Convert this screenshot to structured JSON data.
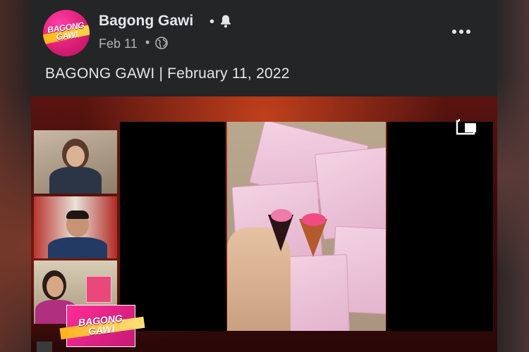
{
  "post": {
    "page_name": "Bagong Gawi",
    "date": "Feb 11",
    "text": "BAGONG GAWI | February 11, 2022",
    "avatar_logo_text": "BAGONG GAWI",
    "video_logo_text": "BAGONG GAWI"
  },
  "icons": {
    "bell": "bell-icon",
    "audience": "globe-icon",
    "more": "more-options-icon",
    "pip": "picture-in-picture-icon"
  },
  "colors": {
    "card_bg": "#242526",
    "primary_text": "#e4e6eb",
    "secondary_text": "#b0b3b8",
    "brand_pink": "#e0217a",
    "brand_yellow": "#ffb21c"
  }
}
